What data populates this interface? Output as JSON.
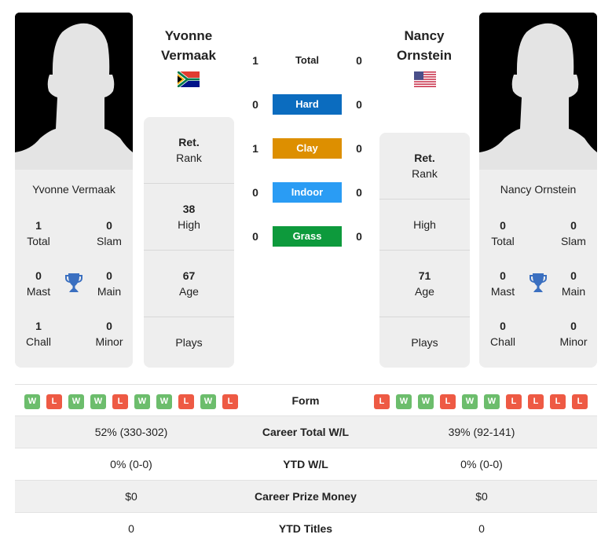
{
  "players": {
    "left": {
      "name": "Yvonne Vermaak",
      "name_line1": "Yvonne",
      "name_line2": "Vermaak",
      "country_flag": "south-africa-flag",
      "titles": {
        "total": {
          "value": "1",
          "label": "Total"
        },
        "slam": {
          "value": "0",
          "label": "Slam"
        },
        "mast": {
          "value": "0",
          "label": "Mast"
        },
        "main": {
          "value": "0",
          "label": "Main"
        },
        "chall": {
          "value": "1",
          "label": "Chall"
        },
        "minor": {
          "value": "0",
          "label": "Minor"
        }
      },
      "info": {
        "rank": {
          "value": "Ret.",
          "label": "Rank"
        },
        "high": {
          "value": "38",
          "label": "High"
        },
        "age": {
          "value": "67",
          "label": "Age"
        },
        "plays": {
          "value": "",
          "label": "Plays"
        }
      },
      "form": [
        "W",
        "L",
        "W",
        "W",
        "L",
        "W",
        "W",
        "L",
        "W",
        "L"
      ]
    },
    "right": {
      "name": "Nancy Ornstein",
      "name_line1": "Nancy",
      "name_line2": "Ornstein",
      "country_flag": "usa-flag",
      "titles": {
        "total": {
          "value": "0",
          "label": "Total"
        },
        "slam": {
          "value": "0",
          "label": "Slam"
        },
        "mast": {
          "value": "0",
          "label": "Mast"
        },
        "main": {
          "value": "0",
          "label": "Main"
        },
        "chall": {
          "value": "0",
          "label": "Chall"
        },
        "minor": {
          "value": "0",
          "label": "Minor"
        }
      },
      "info": {
        "rank": {
          "value": "Ret.",
          "label": "Rank"
        },
        "high": {
          "value": "",
          "label": "High"
        },
        "age": {
          "value": "71",
          "label": "Age"
        },
        "plays": {
          "value": "",
          "label": "Plays"
        }
      },
      "form": [
        "L",
        "W",
        "W",
        "L",
        "W",
        "W",
        "L",
        "L",
        "L",
        "L"
      ]
    }
  },
  "h2h": [
    {
      "label": "Total",
      "left": "1",
      "right": "0",
      "color": ""
    },
    {
      "label": "Hard",
      "left": "0",
      "right": "0",
      "color": "#0b6cbf"
    },
    {
      "label": "Clay",
      "left": "1",
      "right": "0",
      "color": "#dd8f00"
    },
    {
      "label": "Indoor",
      "left": "0",
      "right": "0",
      "color": "#2a9cf4"
    },
    {
      "label": "Grass",
      "left": "0",
      "right": "0",
      "color": "#0d9a3c"
    }
  ],
  "form_label": "Form",
  "stats_table": [
    {
      "label": "Career Total W/L",
      "left": "52% (330-302)",
      "right": "39% (92-141)"
    },
    {
      "label": "YTD W/L",
      "left": "0% (0-0)",
      "right": "0% (0-0)"
    },
    {
      "label": "Career Prize Money",
      "left": "$0",
      "right": "$0"
    },
    {
      "label": "YTD Titles",
      "left": "0",
      "right": "0"
    }
  ],
  "colors": {
    "win": "#6cbd6c",
    "loss": "#ee5a44",
    "trophy": "#3a6fc0"
  }
}
